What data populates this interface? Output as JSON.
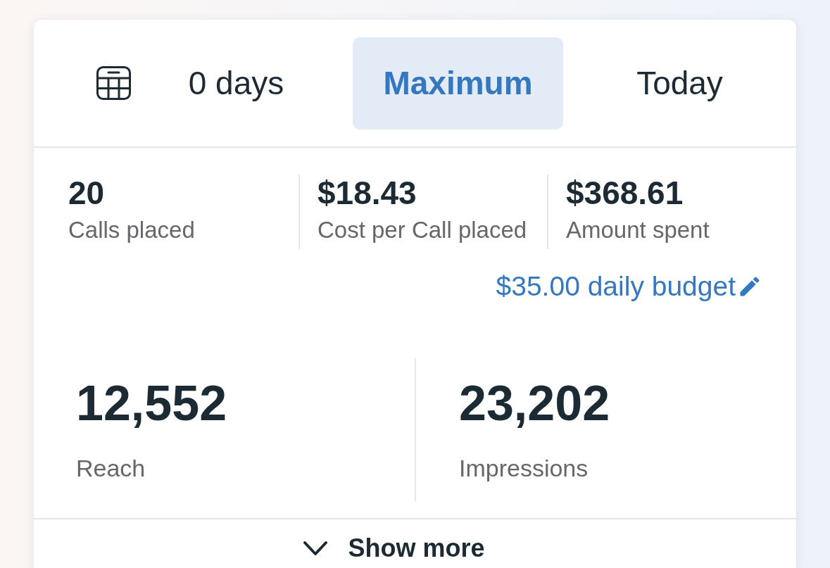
{
  "date_range_tabs": [
    {
      "label": "0 days",
      "selected": false
    },
    {
      "label": "Maximum",
      "selected": true
    },
    {
      "label": "Today",
      "selected": false
    }
  ],
  "summary_metrics": [
    {
      "value": "20",
      "label": "Calls placed"
    },
    {
      "value": "$18.43",
      "label": "Cost per Call placed"
    },
    {
      "value": "$368.61",
      "label": "Amount spent"
    }
  ],
  "budget_link": "$35.00 daily budget",
  "delivery_metrics": [
    {
      "value": "12,552",
      "label": "Reach"
    },
    {
      "value": "23,202",
      "label": "Impressions"
    }
  ],
  "show_more": "Show more"
}
